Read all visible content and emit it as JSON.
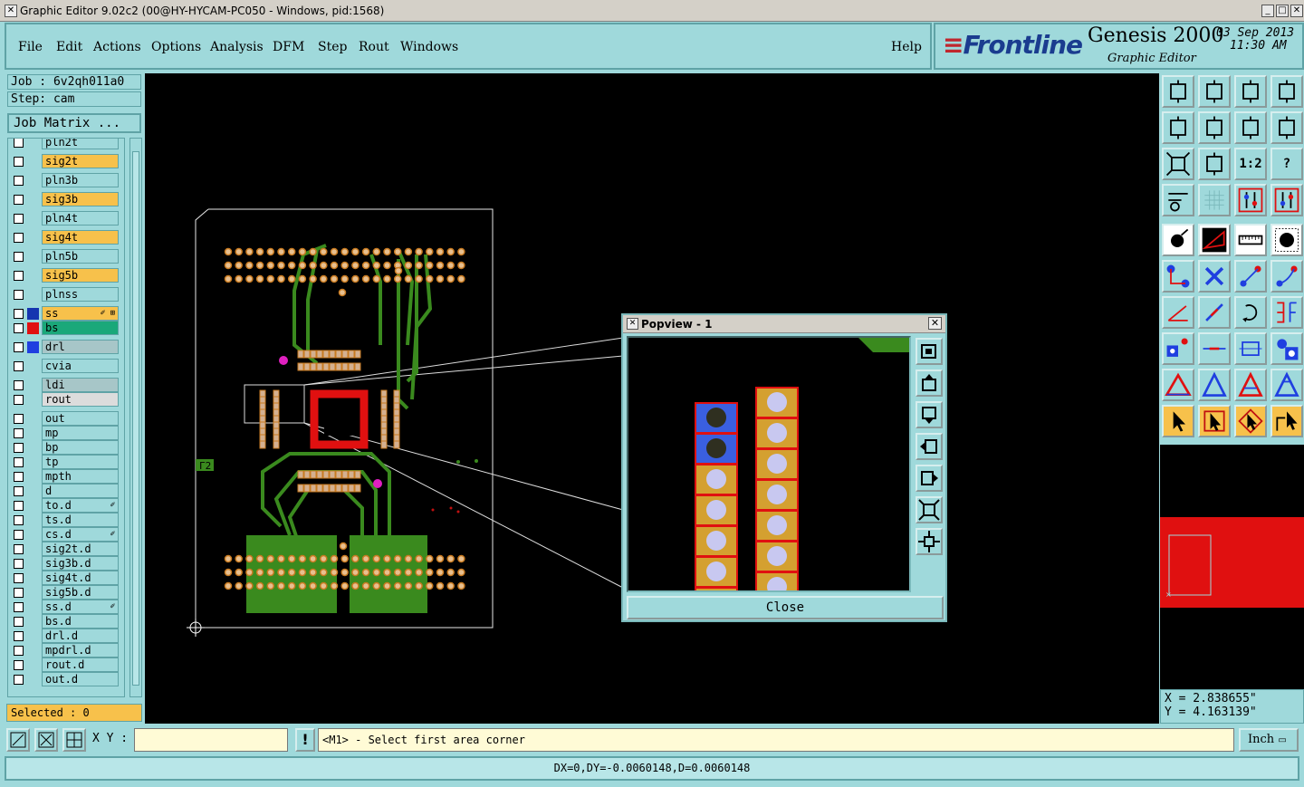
{
  "window": {
    "title": "Graphic Editor 9.02c2 (00@HY-HYCAM-PC050 - Windows, pid:1568)",
    "controls": [
      "_",
      "□",
      "✕"
    ]
  },
  "menu": {
    "items": [
      "File",
      "Edit",
      "Actions",
      "Options",
      "Analysis",
      "DFM",
      "Step",
      "Rout",
      "Windows"
    ],
    "help": "Help"
  },
  "brand": {
    "logo": "Frontline",
    "product": "Genesis 2000",
    "subtitle": "Graphic Editor",
    "date": "03 Sep 2013",
    "time": "11:30 AM"
  },
  "job": {
    "job_line": "Job : 6v2qh011a0",
    "step_line": "Step: cam",
    "matrix_button": "Job Matrix ..."
  },
  "layers": [
    {
      "name": "pln2t",
      "color": "#9fd9db"
    },
    {
      "name": "sig2t",
      "color": "#f7c14b"
    },
    {
      "name": "pln3b",
      "color": "#9fd9db"
    },
    {
      "name": "sig3b",
      "color": "#f7c14b"
    },
    {
      "name": "pln4t",
      "color": "#9fd9db"
    },
    {
      "name": "sig4t",
      "color": "#f7c14b"
    },
    {
      "name": "pln5b",
      "color": "#9fd9db"
    },
    {
      "name": "sig5b",
      "color": "#f7c14b"
    },
    {
      "name": "plnss",
      "color": "#9fd9db"
    },
    {
      "name": "ss",
      "color": "#f7c14b",
      "mark": "#1535b0",
      "marker": "✐ ⊞"
    },
    {
      "name": "bs",
      "color": "#1aa87a",
      "mark": "#e01010"
    },
    {
      "name": "drl",
      "color": "#a7c6c8",
      "mark": "#1f3fe0"
    },
    {
      "name": "cvia",
      "color": "#9fd9db"
    },
    {
      "name": "ldi",
      "color": "#a7c6c8"
    },
    {
      "name": "rout",
      "color": "#dcdcdc"
    },
    {
      "name": "out",
      "color": "#9fd9db"
    },
    {
      "name": "mp",
      "color": "#9fd9db"
    },
    {
      "name": "bp",
      "color": "#9fd9db"
    },
    {
      "name": "tp",
      "color": "#9fd9db"
    },
    {
      "name": "mpth",
      "color": "#9fd9db"
    },
    {
      "name": "d",
      "color": "#9fd9db"
    },
    {
      "name": "to.d",
      "color": "#9fd9db",
      "marker": "✐"
    },
    {
      "name": "ts.d",
      "color": "#9fd9db"
    },
    {
      "name": "cs.d",
      "color": "#9fd9db",
      "marker": "✐"
    },
    {
      "name": "sig2t.d",
      "color": "#9fd9db"
    },
    {
      "name": "sig3b.d",
      "color": "#9fd9db"
    },
    {
      "name": "sig4t.d",
      "color": "#9fd9db"
    },
    {
      "name": "sig5b.d",
      "color": "#9fd9db"
    },
    {
      "name": "ss.d",
      "color": "#9fd9db",
      "marker": "✐"
    },
    {
      "name": "bs.d",
      "color": "#9fd9db"
    },
    {
      "name": "drl.d",
      "color": "#9fd9db"
    },
    {
      "name": "mpdrl.d",
      "color": "#9fd9db"
    },
    {
      "name": "rout.d",
      "color": "#9fd9db"
    },
    {
      "name": "out.d",
      "color": "#9fd9db"
    }
  ],
  "selected": "Selected : 0",
  "popview": {
    "title": "Popview - 1",
    "close": "Close"
  },
  "board": {
    "label": "Γ2"
  },
  "toolbar_right": {
    "labels": [
      "1:2",
      "?"
    ]
  },
  "coords": {
    "x": "X = 2.838655\"",
    "y": "Y = 4.163139\""
  },
  "bottom": {
    "xy_label": "X Y :",
    "xy_value": "",
    "prompt": "<M1> - Select first area corner",
    "unit": "Inch",
    "status": "DX=0,DY=-0.0060148,D=0.0060148"
  }
}
